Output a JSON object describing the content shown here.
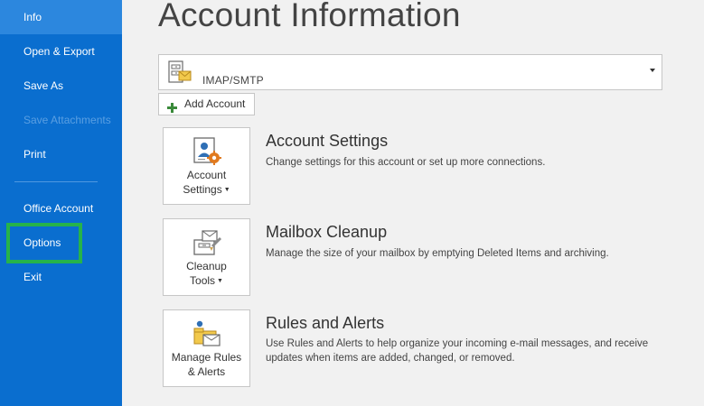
{
  "sidebar": {
    "items": [
      {
        "label": "Info"
      },
      {
        "label": "Open & Export"
      },
      {
        "label": "Save As"
      },
      {
        "label": "Save Attachments"
      },
      {
        "label": "Print"
      },
      {
        "label": "Office Account"
      },
      {
        "label": "Options"
      },
      {
        "label": "Exit"
      }
    ],
    "active_item": "Info",
    "disabled_item": "Save Attachments",
    "highlighted_item": "Options"
  },
  "colors": {
    "sidebar_bg": "#0a6ecf",
    "sidebar_active_bg": "#2c87de",
    "highlight_border": "#26b34a",
    "main_bg": "#f1f1f1"
  },
  "main": {
    "title": "Account Information",
    "account": {
      "name": "",
      "type": "IMAP/SMTP",
      "icon": "mail-account-icon"
    },
    "add_account_label": "Add Account",
    "sections": [
      {
        "tile_line1": "Account",
        "tile_line2": "Settings",
        "tile_icon": "account-settings-icon",
        "title": "Account Settings",
        "description": "Change settings for this account or set up more connections."
      },
      {
        "tile_line1": "Cleanup",
        "tile_line2": "Tools",
        "tile_icon": "cleanup-tools-icon",
        "title": "Mailbox Cleanup",
        "description": "Manage the size of your mailbox by emptying Deleted Items and archiving."
      },
      {
        "tile_line1": "Manage Rules",
        "tile_line2": "& Alerts",
        "tile_icon": "rules-alerts-icon",
        "title": "Rules and Alerts",
        "description": "Use Rules and Alerts to help organize your incoming e-mail messages, and receive updates when items are added, changed, or removed."
      }
    ]
  }
}
